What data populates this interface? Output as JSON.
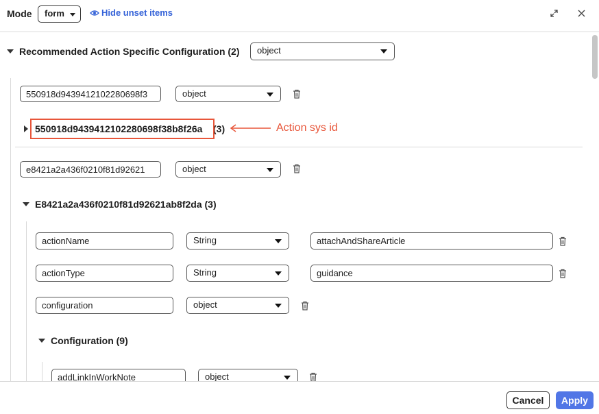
{
  "header": {
    "mode_label": "Mode",
    "mode_value": "form",
    "hide_link": "Hide unset items",
    "icons": [
      "eye-icon",
      "expand-icon",
      "close-icon"
    ]
  },
  "root": {
    "title": "Recommended Action Specific Configuration (2)",
    "type": "object"
  },
  "entry1": {
    "key": "550918d9439412102280698f3",
    "type": "object",
    "title": "550918d943941210228069​8f38b8f26a",
    "count": "(3)"
  },
  "entry2": {
    "key": "e8421a2a436f0210f81d92621",
    "type": "object",
    "title": "E8421a2a436f0210f81d92621ab8f2da (3)"
  },
  "props": [
    {
      "key": "actionName",
      "type": "String",
      "value": "attachAndShareArticle"
    },
    {
      "key": "actionType",
      "type": "String",
      "value": "guidance"
    },
    {
      "key": "configuration",
      "type": "object"
    }
  ],
  "config": {
    "title": "Configuration (9)",
    "first_key": "addLinkInWorkNote",
    "first_type": "object"
  },
  "annotation": {
    "label": "Action sys id",
    "color": "#e8563a"
  },
  "footer": {
    "cancel": "Cancel",
    "apply": "Apply",
    "apply_color": "#5176e6"
  }
}
